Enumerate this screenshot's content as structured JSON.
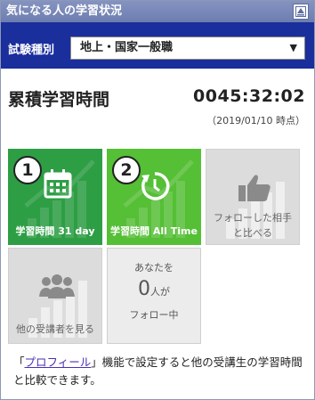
{
  "panel": {
    "title": "気になる人の学習状況"
  },
  "selector": {
    "label": "試験種別",
    "value": "地上・国家一般職"
  },
  "total": {
    "label": "累積学習時間",
    "time": "0045:32:02",
    "as_of": "（2019/01/10 時点）"
  },
  "tiles": [
    {
      "badge": "1",
      "caption": "学習時間 31 day",
      "icon": "calendar-icon"
    },
    {
      "badge": "2",
      "caption": "学習時間 All Time",
      "icon": "clock-icon"
    },
    {
      "caption_line1": "フォローした相手",
      "caption_line2": "と比べる",
      "icon": "thumbs-up-icon"
    },
    {
      "caption": "他の受講者を見る",
      "icon": "people-icon"
    },
    {
      "line1": "あなたを",
      "count": "0",
      "count_unit": "人が",
      "line3": "フォロー中"
    }
  ],
  "note": {
    "prefix": "「",
    "link": "プロフィール",
    "suffix": "」機能で設定すると他の受講生の学習時間と比較できます。"
  },
  "colors": {
    "header_blue": "#1a2e9c",
    "green_dark": "#2e9e45",
    "green_light": "#55bf36",
    "tile_gray": "#dcdcdc"
  }
}
